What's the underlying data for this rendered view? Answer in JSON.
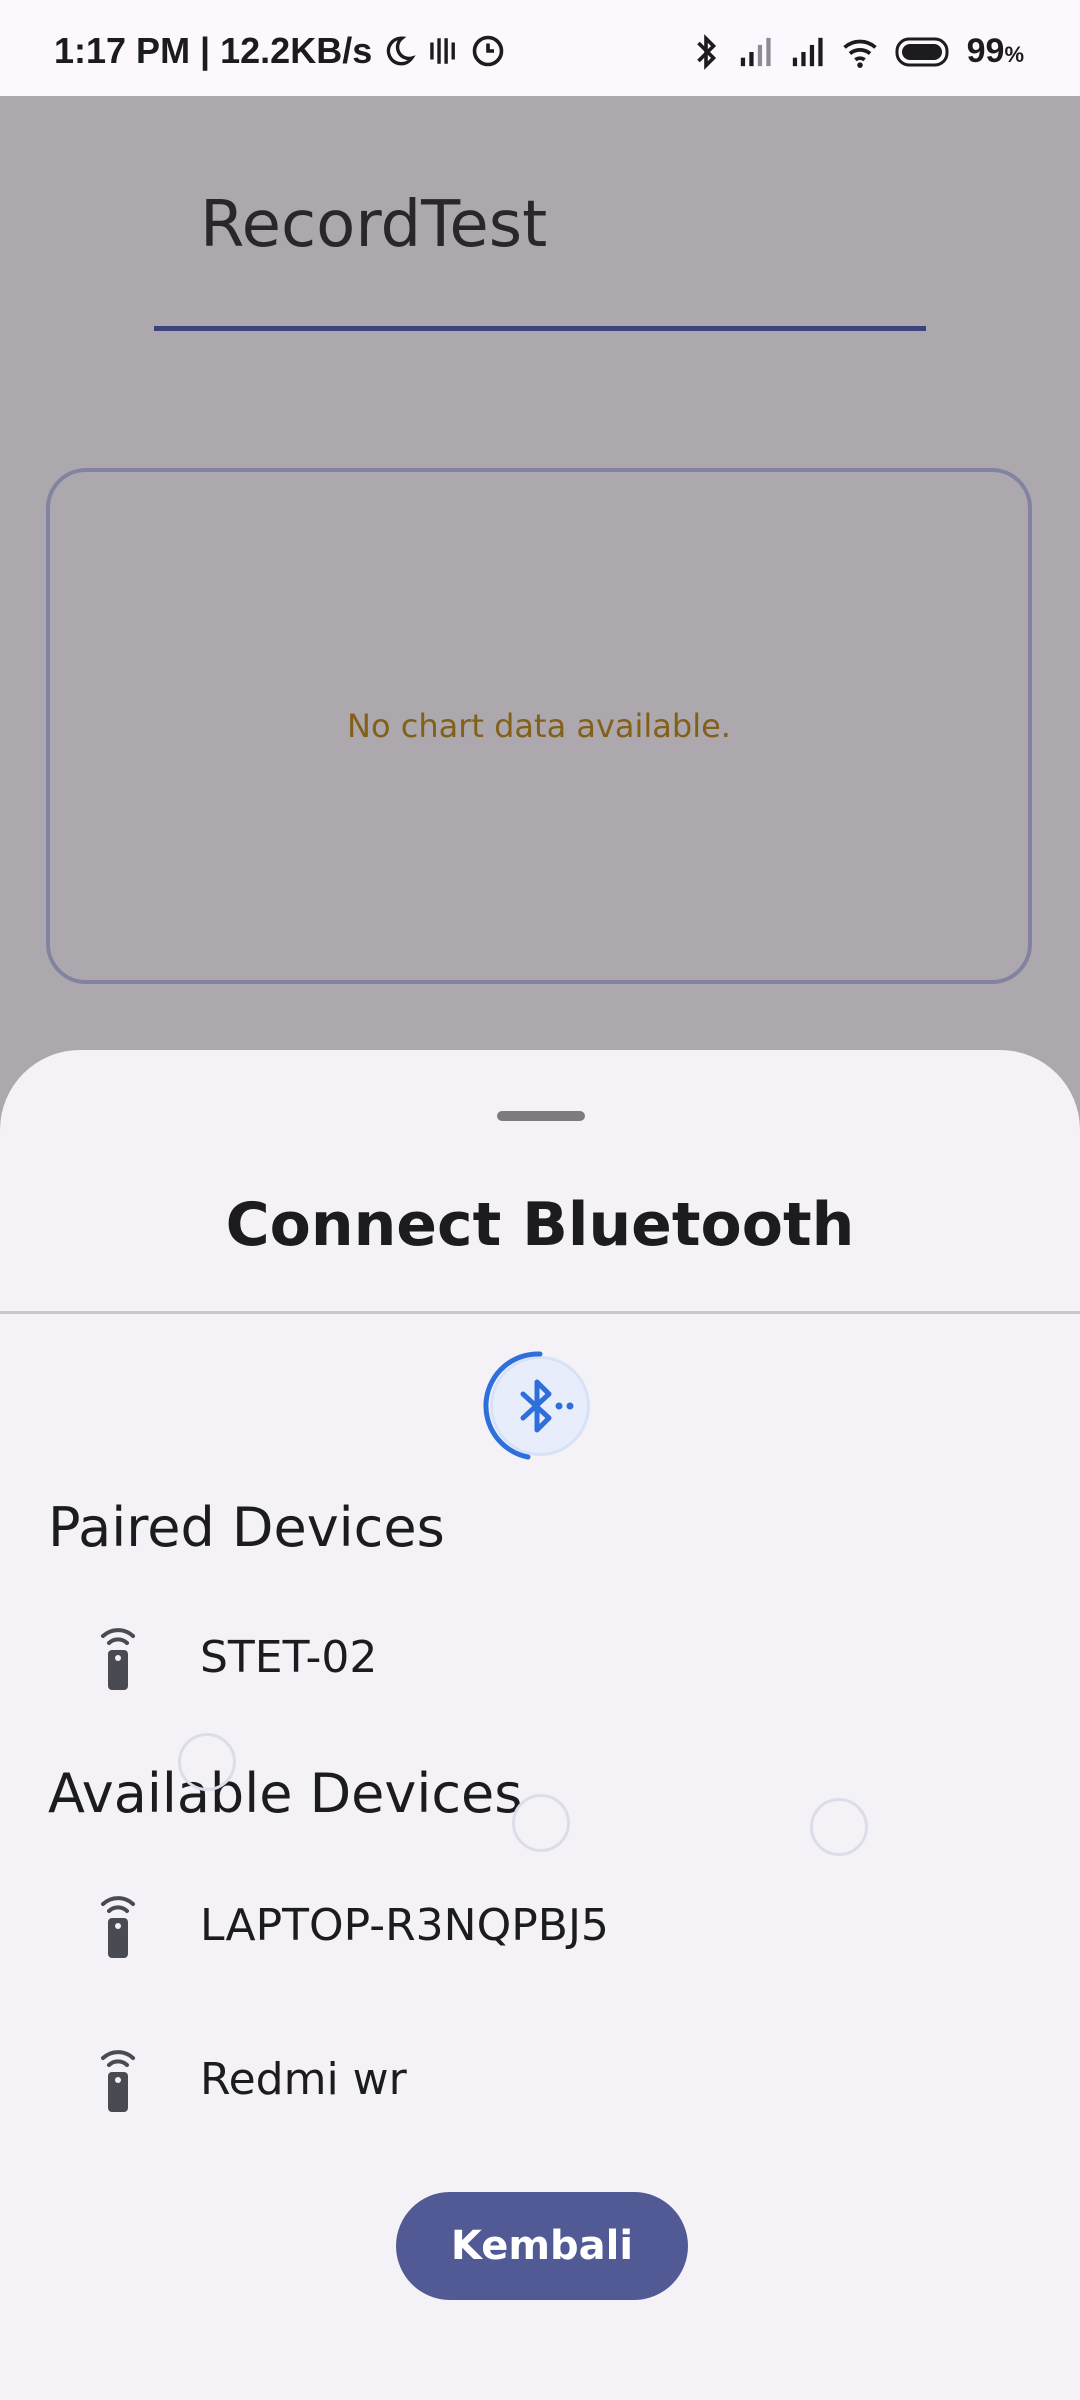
{
  "status_bar": {
    "time_speed": "1:17 PM | 12.2KB/s",
    "battery": "99",
    "battery_unit": "%",
    "icons": [
      "moon-icon",
      "vibrate-icon",
      "alarm-icon",
      "bluetooth-icon",
      "signal-icon",
      "signal-icon",
      "wifi-icon",
      "battery-icon"
    ]
  },
  "main": {
    "app_title": "RecordTest",
    "chart_empty_text": "No chart data available."
  },
  "sheet": {
    "title": "Connect Bluetooth",
    "paired_title": "Paired Devices",
    "paired_devices": [
      {
        "label": "STET-02",
        "icon": "device-remote-icon"
      }
    ],
    "available_title": "Available Devices",
    "available_devices": [
      {
        "label": "LAPTOP-R3NQPBJ5",
        "icon": "device-remote-icon"
      },
      {
        "label": "Redmi wr",
        "icon": "device-remote-icon"
      }
    ],
    "back_button": "Kembali"
  },
  "colors": {
    "accent": "#3e4aa5",
    "button": "#525a95",
    "warning_text": "#b77d00",
    "bluetooth_blue": "#2f6fdc"
  }
}
